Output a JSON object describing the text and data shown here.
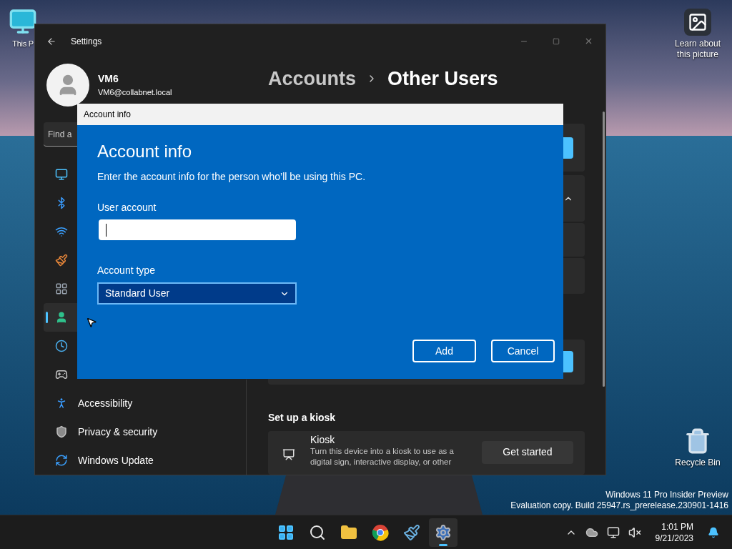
{
  "desktop": {
    "icons": [
      {
        "kind": "pc",
        "label": "This P"
      },
      {
        "kind": "picture",
        "label": "Learn about\nthis picture"
      },
      {
        "kind": "bin",
        "label": "Recycle Bin"
      }
    ],
    "watermark": [
      "Windows 11 Pro Insider Preview",
      "Evaluation copy. Build 25947.rs_prerelease.230901-1416"
    ]
  },
  "settings": {
    "title": "Settings",
    "user": {
      "name": "VM6",
      "email": "VM6@collabnet.local"
    },
    "search": {
      "placeholder": "Find a"
    },
    "nav": [
      {
        "kind": "display",
        "selected": false
      },
      {
        "kind": "bluetooth",
        "selected": false
      },
      {
        "kind": "wifi",
        "selected": false
      },
      {
        "kind": "brush",
        "selected": false
      },
      {
        "kind": "apps",
        "selected": false
      },
      {
        "kind": "accounts",
        "selected": true
      },
      {
        "kind": "time",
        "selected": false
      },
      {
        "kind": "gaming",
        "selected": false
      },
      {
        "kind": "accessibility",
        "label": "Accessibility",
        "selected": false
      },
      {
        "kind": "privacy",
        "label": "Privacy & security",
        "selected": false
      },
      {
        "kind": "update",
        "label": "Windows Update",
        "selected": false
      }
    ],
    "breadcrumb": [
      "Accounts",
      "Other Users"
    ],
    "kiosk": {
      "heading": "Set up a kiosk",
      "title": "Kiosk",
      "description": "Turn this device into a kiosk to use as a digital sign, interactive display, or other",
      "button": "Get started"
    }
  },
  "dialog": {
    "title": "Account info",
    "heading": "Account info",
    "description": "Enter the account info for the person who’ll be using this PC.",
    "user_account": {
      "label": "User account"
    },
    "account_type": {
      "label": "Account type",
      "value": "Standard User"
    },
    "buttons": [
      "Add",
      "Cancel"
    ]
  },
  "taskbar": {
    "apps": [
      {
        "kind": "start",
        "active": false
      },
      {
        "kind": "search",
        "active": false
      },
      {
        "kind": "explorer",
        "active": false
      },
      {
        "kind": "browser",
        "active": false
      },
      {
        "kind": "paint",
        "active": false
      },
      {
        "kind": "settings",
        "active": true
      }
    ],
    "time": "1:01 PM",
    "date": "9/21/2023"
  }
}
